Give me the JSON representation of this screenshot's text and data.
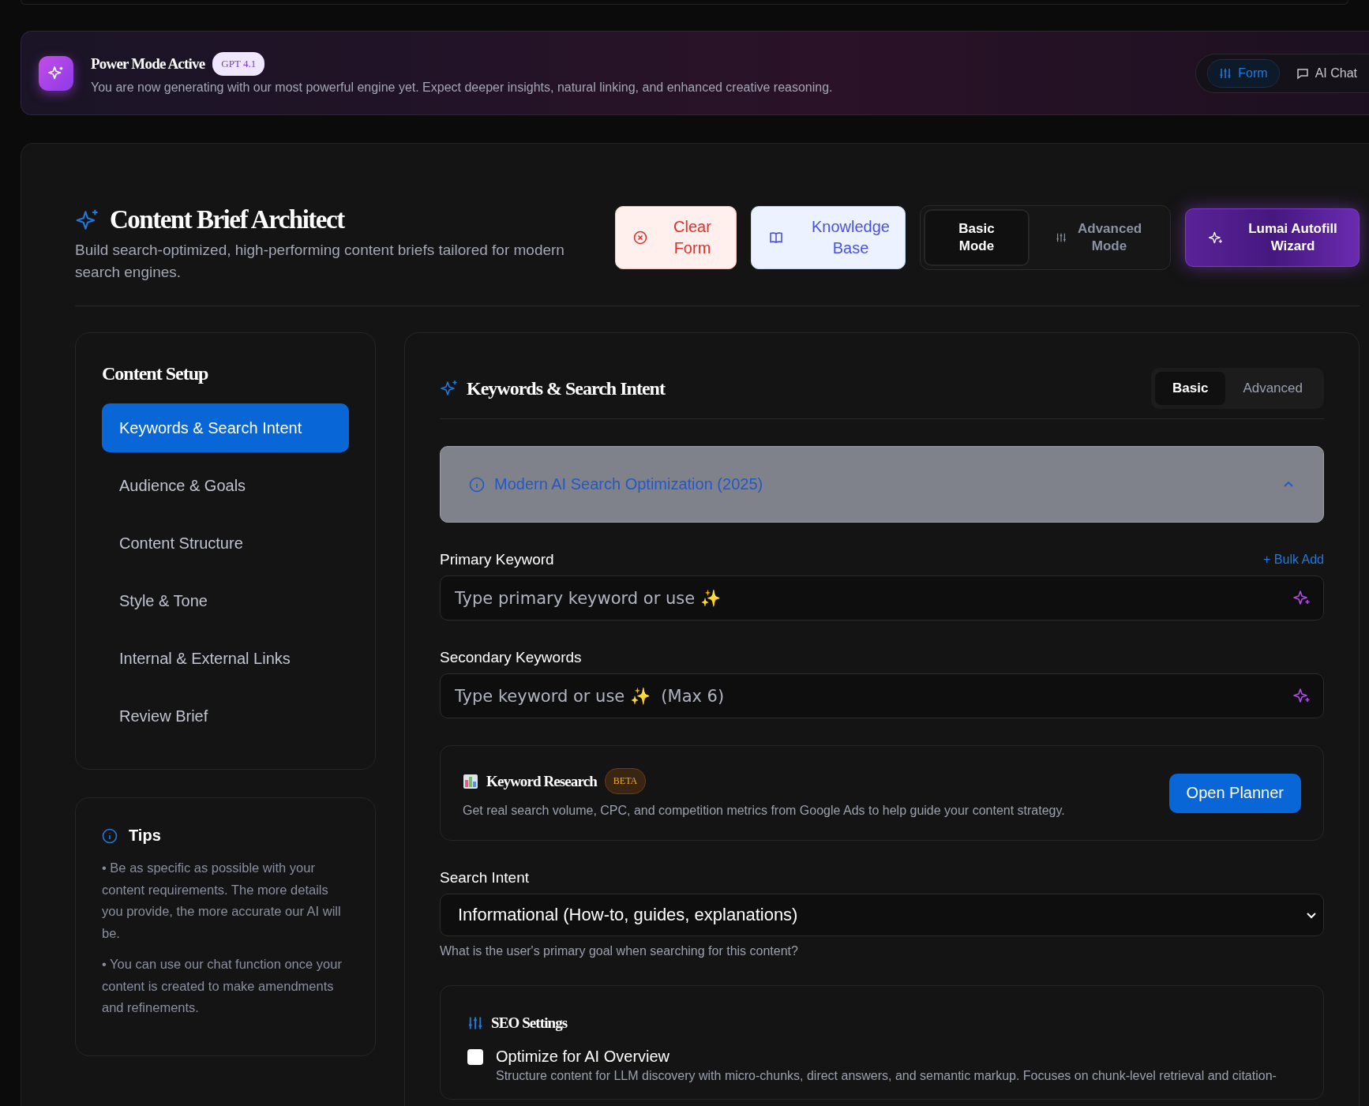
{
  "banner": {
    "title": "Power Mode Active",
    "badge": "GPT 4.1",
    "text": "You are now generating with our most powerful engine yet. Expect deeper insights, natural linking, and enhanced creative reasoning.",
    "view_toggle": [
      {
        "label": "Form",
        "kind": "form",
        "selected": true
      },
      {
        "label": "AI Chat",
        "kind": "chat",
        "selected": false
      }
    ]
  },
  "header": {
    "title": "Content Brief Architect",
    "subtitle": "Build search-optimized, high-performing content briefs tailored for modern search engines.",
    "clear_button": "Clear Form",
    "knowledge_button": "Knowledge Base",
    "modes": [
      {
        "label": "Basic Mode",
        "selected": true
      },
      {
        "label": "Advanced Mode",
        "selected": false
      }
    ],
    "wizard_button": "Lumai Autofill Wizard"
  },
  "sidebar": {
    "title": "Content Setup",
    "items": [
      {
        "label": "Keywords & Search Intent",
        "selected": true
      },
      {
        "label": "Audience & Goals",
        "selected": false
      },
      {
        "label": "Content Structure",
        "selected": false
      },
      {
        "label": "Style & Tone",
        "selected": false
      },
      {
        "label": "Internal & External Links",
        "selected": false
      },
      {
        "label": "Review Brief",
        "selected": false
      }
    ]
  },
  "tips": {
    "title": "Tips",
    "items": [
      "• Be as specific as possible with your content requirements. The more details you provide, the more accurate our AI will be.",
      "• You can use our chat function once your content is created to make amendments and refinements."
    ]
  },
  "panel": {
    "title": "Keywords & Search Intent",
    "tabs": [
      {
        "label": "Basic",
        "selected": true
      },
      {
        "label": "Advanced",
        "selected": false
      }
    ],
    "notice": {
      "title": "Modern AI Search Optimization (2025)",
      "expanded": true
    },
    "primary": {
      "label": "Primary Keyword",
      "action": "+ Bulk Add",
      "placeholder": "Type primary keyword or use ✨"
    },
    "secondary": {
      "label": "Secondary Keywords",
      "placeholder": "Type keyword or use ✨  (Max 6)"
    },
    "research": {
      "title": "Keyword Research",
      "badge": "BETA",
      "text": "Get real search volume, CPC, and competition metrics from Google Ads to help guide your content strategy.",
      "button": "Open Planner"
    },
    "intent": {
      "label": "Search Intent",
      "value": "Informational (How-to, guides, explanations)",
      "help": "What is the user's primary goal when searching for this content?"
    },
    "seo": {
      "title": "SEO Settings",
      "options": [
        {
          "label": "Optimize for AI Overview",
          "checked": false,
          "description": "Structure content for LLM discovery with micro-chunks, direct answers, and semantic markup. Focuses on chunk-level retrieval and citation-"
        }
      ]
    }
  }
}
